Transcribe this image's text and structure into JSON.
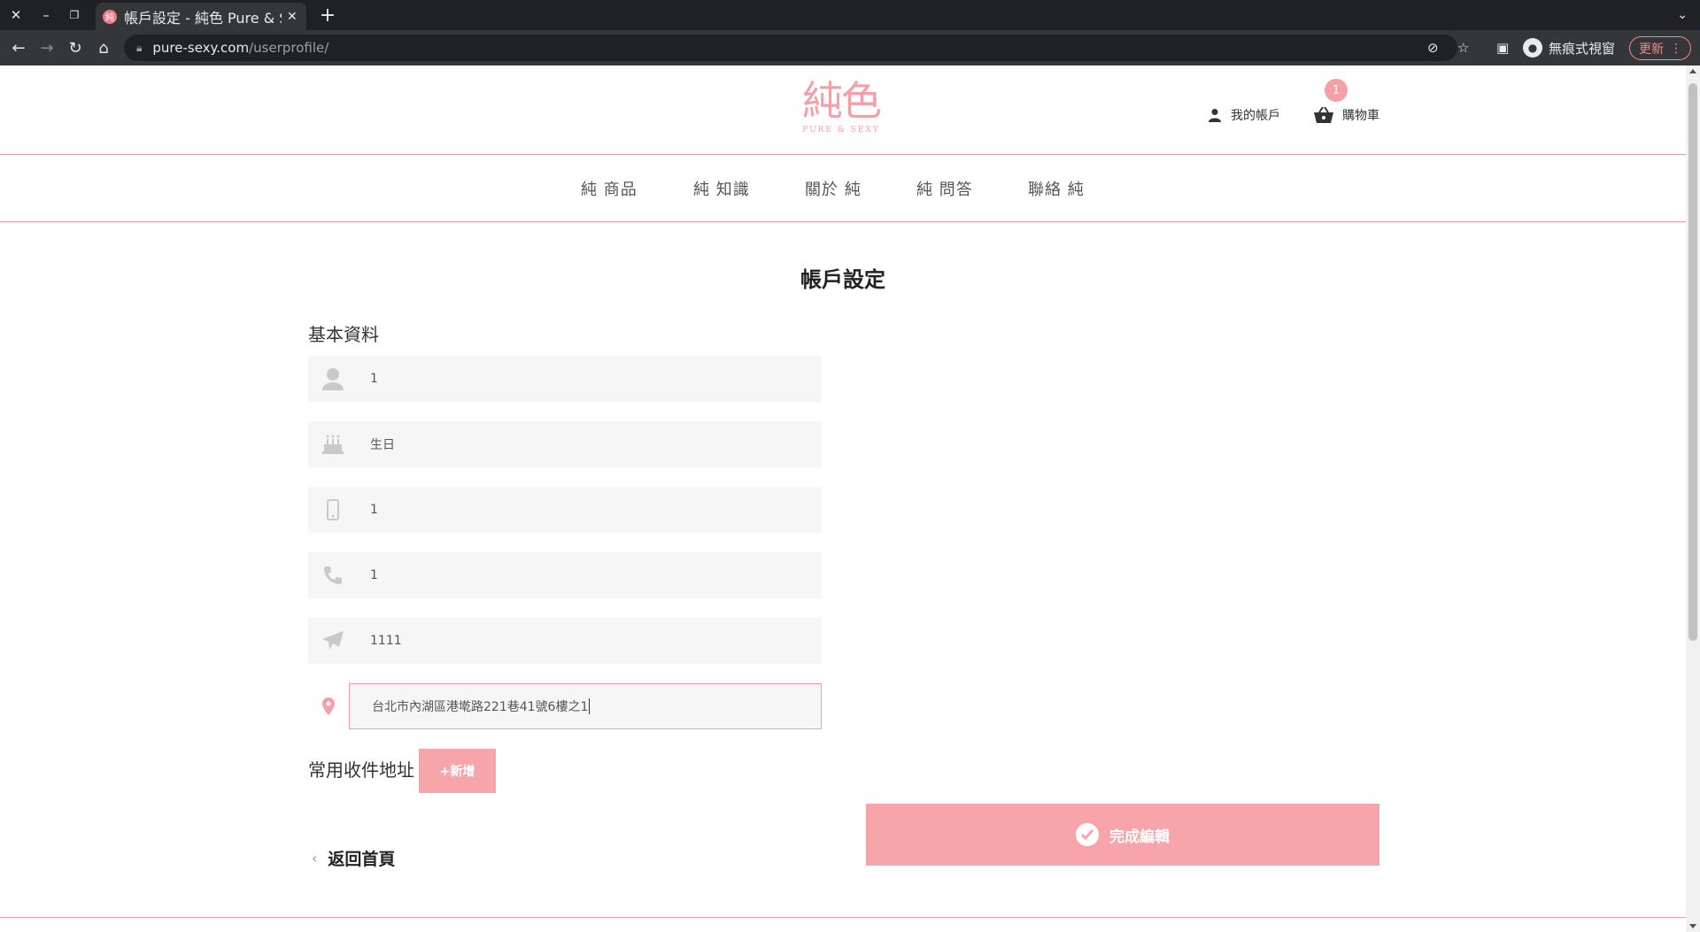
{
  "browser": {
    "tab_title": "帳戶設定 - 純色 Pure & Sexy",
    "tab_favicon": "純",
    "url_host": "pure-sexy.com",
    "url_path": "/userprofile/",
    "incognito_label": "無痕式視窗",
    "update_label": "更新"
  },
  "site": {
    "logo_text": "純色",
    "logo_sub": "PURE & SEXY",
    "account_label": "我的帳戶",
    "cart_label": "購物車",
    "cart_count": "1",
    "accent_color": "#f7a5aa"
  },
  "menu": [
    {
      "label": "純 商品"
    },
    {
      "label": "純 知識"
    },
    {
      "label": "關於 純"
    },
    {
      "label": "純 問答"
    },
    {
      "label": "聯絡 純"
    }
  ],
  "page": {
    "title": "帳戶設定",
    "section_title": "基本資料",
    "fields": [
      {
        "icon": "user-icon",
        "value": "1"
      },
      {
        "icon": "birthday-cake-icon",
        "value": "生日"
      },
      {
        "icon": "mobile-phone-icon",
        "value": "1"
      },
      {
        "icon": "phone-icon",
        "value": "1"
      },
      {
        "icon": "paper-plane-icon",
        "value": "1111"
      },
      {
        "icon": "map-marker-icon",
        "value": "台北市內湖區港墘路221巷41號6樓之1"
      }
    ],
    "address_title": "常用收件地址",
    "add_button": "+新增",
    "done_button": "完成編輯",
    "back_link": "返回首頁"
  }
}
